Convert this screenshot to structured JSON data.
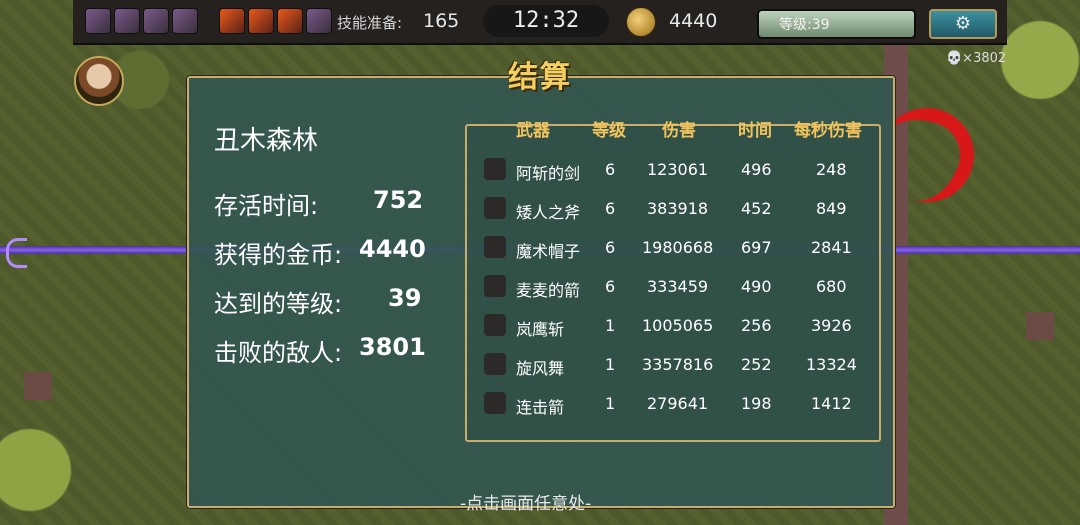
{
  "hud": {
    "skill_label": "技能准备:",
    "skill_value": "165",
    "timer": "12:32",
    "gold": "4440",
    "level_label": "等级:39",
    "level_progress": 1.0,
    "gear_icon": "⚙",
    "kill_count": "💀×3802",
    "icons": [
      "sword-icon",
      "axe-icon",
      "hat-icon",
      "bow-icon",
      "fire-sword-icon",
      "fire-axe-icon",
      "fire-hat-icon",
      "fire-bow-icon"
    ]
  },
  "result": {
    "title": "结算",
    "stage_name": "丑木森林",
    "stats": [
      {
        "label": "存活时间:",
        "value": "752"
      },
      {
        "label": "获得的金币:",
        "value": "4440"
      },
      {
        "label": "达到的等级:",
        "value": "39"
      },
      {
        "label": "击败的敌人:",
        "value": "3801"
      }
    ],
    "table_headers": [
      "武器",
      "等级",
      "伤害",
      "时间",
      "每秒伤害"
    ],
    "weapons": [
      {
        "name": "阿斩的剑",
        "level": "6",
        "damage": "123061",
        "time": "496",
        "dps": "248",
        "icon": "sword-icon"
      },
      {
        "name": "矮人之斧",
        "level": "6",
        "damage": "383918",
        "time": "452",
        "dps": "849",
        "icon": "axe-icon"
      },
      {
        "name": "魔术帽子",
        "level": "6",
        "damage": "1980668",
        "time": "697",
        "dps": "2841",
        "icon": "hat-icon"
      },
      {
        "name": "麦麦的箭",
        "level": "6",
        "damage": "333459",
        "time": "490",
        "dps": "680",
        "icon": "bow-icon"
      },
      {
        "name": "岚鹰斩",
        "level": "1",
        "damage": "1005065",
        "time": "256",
        "dps": "3926",
        "icon": "blade-icon"
      },
      {
        "name": "旋风舞",
        "level": "1",
        "damage": "3357816",
        "time": "252",
        "dps": "13324",
        "icon": "whirlwind-icon"
      },
      {
        "name": "连击箭",
        "level": "1",
        "damage": "279641",
        "time": "198",
        "dps": "1412",
        "icon": "multi-arrow-icon"
      }
    ],
    "footer": "-点击画面任意处-"
  }
}
